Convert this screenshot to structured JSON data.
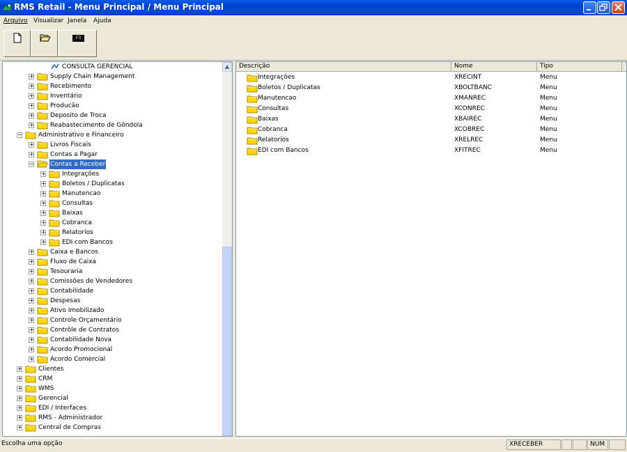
{
  "window": {
    "title": "RMS Retail - Menu Principal / Menu Principal",
    "buttons": [
      "minimize",
      "maximize",
      "close"
    ]
  },
  "menu": [
    {
      "label": "Arquivo",
      "mnemonic": "A"
    },
    {
      "label": "Visualizar",
      "mnemonic": "V"
    },
    {
      "label": "Janela",
      "mnemonic": "J"
    },
    {
      "label": "Ajuda",
      "mnemonic": "u"
    }
  ],
  "toolbar": {
    "new_icon": "new-document-icon",
    "open_icon": "open-folder-icon",
    "f3_label": "F3"
  },
  "tree": [
    {
      "label": "CONSULTA GERENCIAL",
      "level": 3,
      "icon": "program-icon",
      "expander": "none"
    },
    {
      "label": "Supply Chain Management",
      "level": 2,
      "expander": "plus"
    },
    {
      "label": "Recebimento",
      "level": 2,
      "expander": "plus"
    },
    {
      "label": "Inventário",
      "level": 2,
      "expander": "plus"
    },
    {
      "label": "Producão",
      "level": 2,
      "expander": "plus"
    },
    {
      "label": "Deposito de Troca",
      "level": 2,
      "expander": "plus"
    },
    {
      "label": "Reabastecimento de Gôndola",
      "level": 2,
      "expander": "plus"
    },
    {
      "label": "Administrativo e Financeiro",
      "level": 1,
      "expander": "minus"
    },
    {
      "label": "Livros Fiscais",
      "level": 2,
      "expander": "plus"
    },
    {
      "label": "Contas a Pagar",
      "level": 2,
      "expander": "plus"
    },
    {
      "label": "Contas a Receber",
      "level": 2,
      "expander": "minus",
      "selected": true,
      "open": true
    },
    {
      "label": "Integrações",
      "level": 3,
      "expander": "plus"
    },
    {
      "label": "Boletos / Duplicatas",
      "level": 3,
      "expander": "plus"
    },
    {
      "label": "Manutencao",
      "level": 3,
      "expander": "plus"
    },
    {
      "label": "Consultas",
      "level": 3,
      "expander": "plus"
    },
    {
      "label": "Baixas",
      "level": 3,
      "expander": "plus"
    },
    {
      "label": "Cobranca",
      "level": 3,
      "expander": "plus"
    },
    {
      "label": "Relatorios",
      "level": 3,
      "expander": "plus"
    },
    {
      "label": "EDI com Bancos",
      "level": 3,
      "expander": "plus"
    },
    {
      "label": "Caixa e Bancos",
      "level": 2,
      "expander": "plus"
    },
    {
      "label": "Fluxo de Caixa",
      "level": 2,
      "expander": "plus"
    },
    {
      "label": "Tesouraria",
      "level": 2,
      "expander": "plus"
    },
    {
      "label": "Comissões de Vendedores",
      "level": 2,
      "expander": "plus"
    },
    {
      "label": "Contabilidade",
      "level": 2,
      "expander": "plus"
    },
    {
      "label": "Despesas",
      "level": 2,
      "expander": "plus"
    },
    {
      "label": "Ativo Imobilizado",
      "level": 2,
      "expander": "plus"
    },
    {
      "label": "Controle Orçamentário",
      "level": 2,
      "expander": "plus"
    },
    {
      "label": "Contrôle de Contratos",
      "level": 2,
      "expander": "plus"
    },
    {
      "label": "Contabilidade Nova",
      "level": 2,
      "expander": "plus"
    },
    {
      "label": "Acordo Promocional",
      "level": 2,
      "expander": "plus"
    },
    {
      "label": "Acordo Comercial",
      "level": 2,
      "expander": "plus"
    },
    {
      "label": "Clientes",
      "level": 1,
      "expander": "plus"
    },
    {
      "label": "CRM",
      "level": 1,
      "expander": "plus"
    },
    {
      "label": "WMS",
      "level": 1,
      "expander": "plus"
    },
    {
      "label": "Gerencial",
      "level": 1,
      "expander": "plus"
    },
    {
      "label": "EDI / Interfaces",
      "level": 1,
      "expander": "plus"
    },
    {
      "label": "RMS - Administrador",
      "level": 1,
      "expander": "plus"
    },
    {
      "label": "Central de Compras",
      "level": 1,
      "expander": "plus"
    }
  ],
  "list": {
    "columns": [
      "Descrição",
      "Nome",
      "Tipo"
    ],
    "rows": [
      {
        "descricao": "Integrações",
        "nome": "XRECINT",
        "tipo": "Menu"
      },
      {
        "descricao": "Boletos / Duplicatas",
        "nome": "XBOLTBANC",
        "tipo": "Menu"
      },
      {
        "descricao": "Manutencao",
        "nome": "XMANREC",
        "tipo": "Menu"
      },
      {
        "descricao": "Consultas",
        "nome": "XCONREC",
        "tipo": "Menu"
      },
      {
        "descricao": "Baixas",
        "nome": "XBAIREC",
        "tipo": "Menu"
      },
      {
        "descricao": "Cobranca",
        "nome": "XCOBREC",
        "tipo": "Menu"
      },
      {
        "descricao": "Relatorios",
        "nome": "XRELREC",
        "tipo": "Menu"
      },
      {
        "descricao": "EDI com Bancos",
        "nome": "XFITREC",
        "tipo": "Menu"
      }
    ]
  },
  "status": {
    "message": "Escolha uma opção",
    "program": "XRECEBER",
    "num": "NUM"
  },
  "colors": {
    "titlebar": "#0040d0",
    "selection": "#316ac5",
    "folder_fill": "#ffd700",
    "folder_stroke": "#b08800"
  }
}
